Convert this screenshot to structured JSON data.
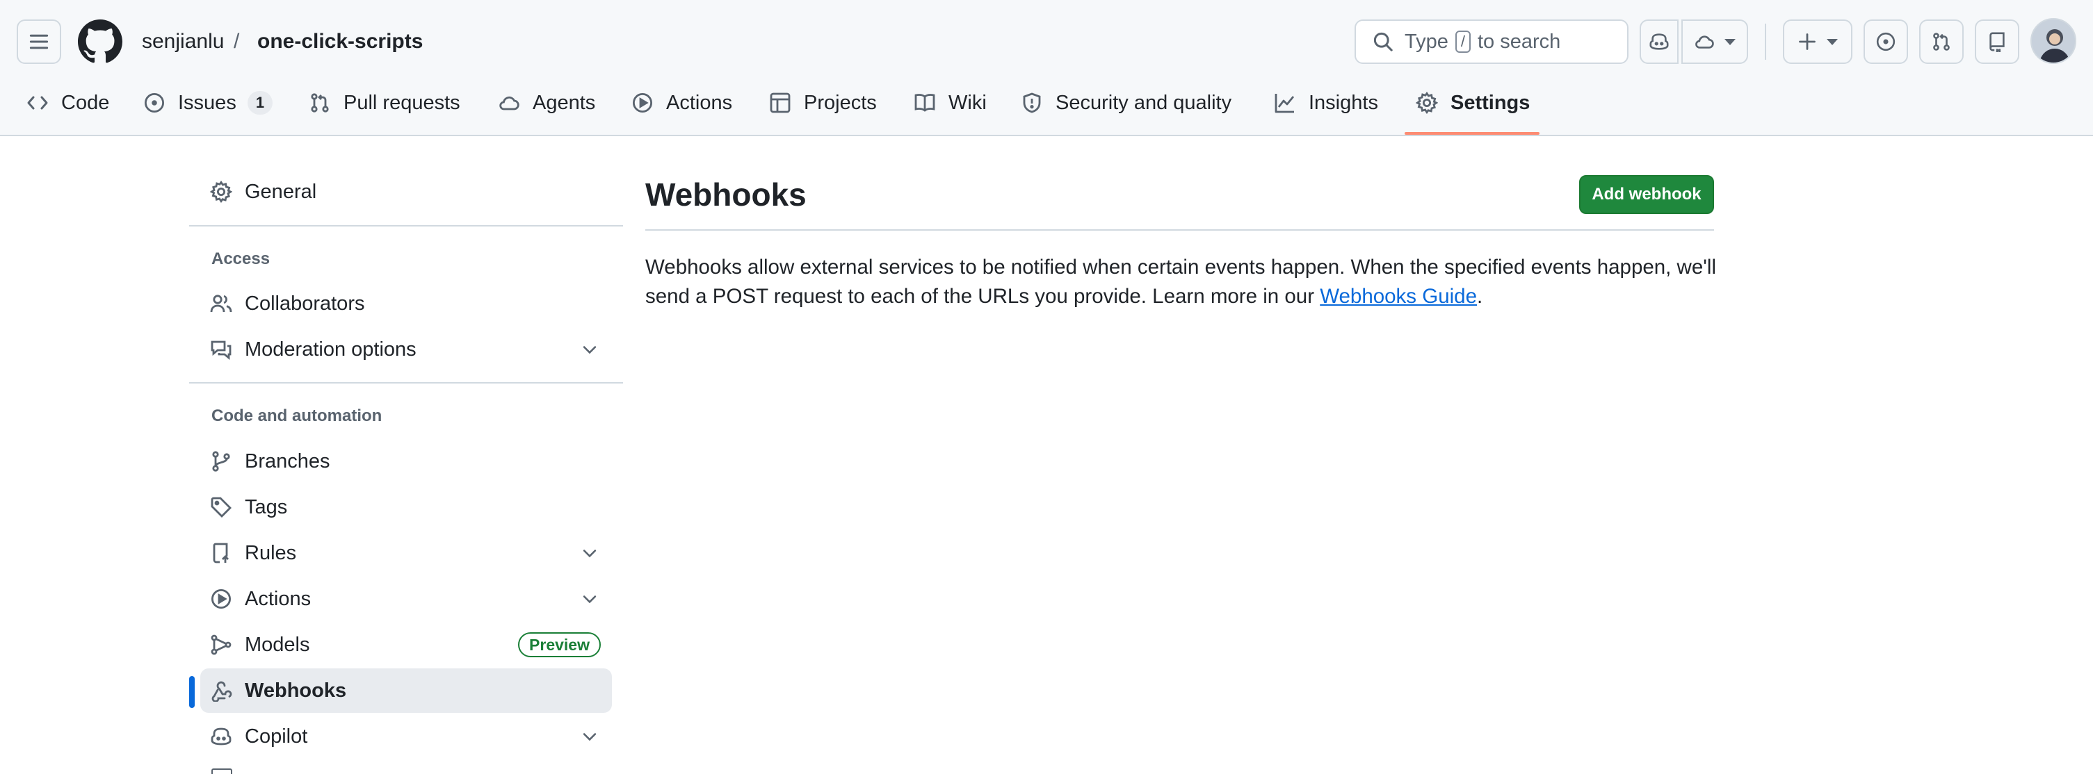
{
  "repo": {
    "owner": "senjianlu",
    "separator": "/",
    "name": "one-click-scripts"
  },
  "search": {
    "prefix": "Type",
    "key": "/",
    "suffix": "to search"
  },
  "tabs": [
    {
      "label": "Code",
      "icon": "code-icon"
    },
    {
      "label": "Issues",
      "icon": "issue-opened-icon",
      "count": "1"
    },
    {
      "label": "Pull requests",
      "icon": "git-pull-request-icon"
    },
    {
      "label": "Agents",
      "icon": "agent-cloud-icon"
    },
    {
      "label": "Actions",
      "icon": "play-icon"
    },
    {
      "label": "Projects",
      "icon": "table-icon"
    },
    {
      "label": "Wiki",
      "icon": "book-icon"
    },
    {
      "label": "Security and quality",
      "icon": "shield-icon"
    },
    {
      "label": "Insights",
      "icon": "graph-icon"
    },
    {
      "label": "Settings",
      "icon": "gear-icon",
      "selected": true
    }
  ],
  "sidebar": {
    "general": "General",
    "access_heading": "Access",
    "collaborators": "Collaborators",
    "moderation": "Moderation options",
    "code_heading": "Code and automation",
    "branches": "Branches",
    "tags": "Tags",
    "rules": "Rules",
    "actions": "Actions",
    "models": "Models",
    "models_badge": "Preview",
    "webhooks": "Webhooks",
    "copilot": "Copilot"
  },
  "main": {
    "title": "Webhooks",
    "add_button": "Add webhook",
    "description_before": "Webhooks allow external services to be notified when certain events happen. When the specified events happen, we'll send a POST request to each of the URLs you provide. Learn more in our ",
    "guide_link": "Webhooks Guide",
    "description_after": "."
  },
  "colors": {
    "accent_link": "#0969da",
    "primary_button": "#1f883d",
    "selected_tab_underline": "#fd8c73",
    "badge_green": "#1a7f37"
  }
}
